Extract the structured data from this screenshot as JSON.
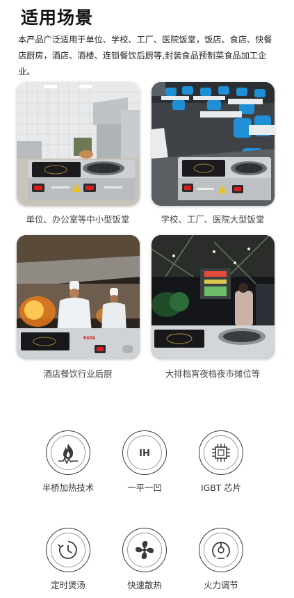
{
  "title": "适用场景",
  "intro": "本产品广泛适用于单位、学校、工厂、医院饭堂，饭店、食店、快餐店厨房，酒店、酒楼、连锁餐饮后厨等,封装食品预制菜食品加工企业。",
  "scenes": [
    {
      "caption": "单位、办公室等中小型饭堂"
    },
    {
      "caption": "学校、工厂、医院大型饭堂"
    },
    {
      "caption": "酒店餐饮行业后厨"
    },
    {
      "caption": "大排档宵夜档夜市摊位等"
    }
  ],
  "features": [
    {
      "label": "半桥加热技术",
      "icon": "flame-wave-icon"
    },
    {
      "label": "一平一凹",
      "icon": "ih-icon",
      "icon_text": "IH"
    },
    {
      "label": "IGBT 芯片",
      "icon": "chip-icon"
    },
    {
      "label": "定时煲汤",
      "icon": "timer-icon"
    },
    {
      "label": "快速散热",
      "icon": "fan-icon"
    },
    {
      "label": "火力调节",
      "icon": "power-dial-icon"
    }
  ],
  "brand_logo": "EGTA",
  "colors": {
    "text": "#222222",
    "icon_stroke": "#3a3a3a",
    "cooker_body": "#cfd3d6",
    "panel_red": "#d62020"
  }
}
